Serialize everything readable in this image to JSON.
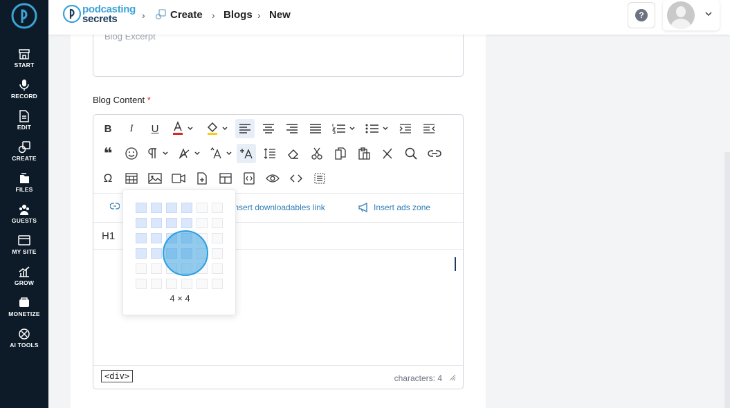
{
  "sidebar": {
    "items": [
      {
        "label": "START",
        "icon": "store-icon"
      },
      {
        "label": "RECORD",
        "icon": "microphone-icon"
      },
      {
        "label": "EDIT",
        "icon": "edit-file-icon"
      },
      {
        "label": "CREATE",
        "icon": "create-icon"
      },
      {
        "label": "FILES",
        "icon": "files-icon"
      },
      {
        "label": "GUESTS",
        "icon": "guests-icon"
      },
      {
        "label": "MY SITE",
        "icon": "site-icon"
      },
      {
        "label": "GROW",
        "icon": "grow-icon"
      },
      {
        "label": "MONETIZE",
        "icon": "monetize-icon"
      },
      {
        "label": "AI TOOLS",
        "icon": "ai-tools-icon"
      }
    ]
  },
  "header": {
    "brand_line1": "podcasting",
    "brand_line2": "secrets",
    "breadcrumb": [
      "Create",
      "Blogs",
      "New"
    ]
  },
  "form": {
    "excerpt_placeholder": "Blog Excerpt",
    "content_label": "Blog Content",
    "required_mark": "*"
  },
  "editor": {
    "links": {
      "downloadables": "Insert downloadables link",
      "ads": "Insert ads zone"
    },
    "block_format": "H1",
    "path_tag": "<div>",
    "char_count": "characters: 4"
  },
  "table_picker": {
    "size_label": "4 × 4",
    "selected_rows": 4,
    "selected_cols": 4,
    "rows": 6,
    "cols": 6
  },
  "colors": {
    "sidebar_bg": "#0d1b28",
    "accent": "#3ba3d8",
    "link": "#2f7fb7",
    "required": "#dc2626",
    "text_color_swatch": "#dc2626",
    "highlight_swatch": "#facc15"
  }
}
